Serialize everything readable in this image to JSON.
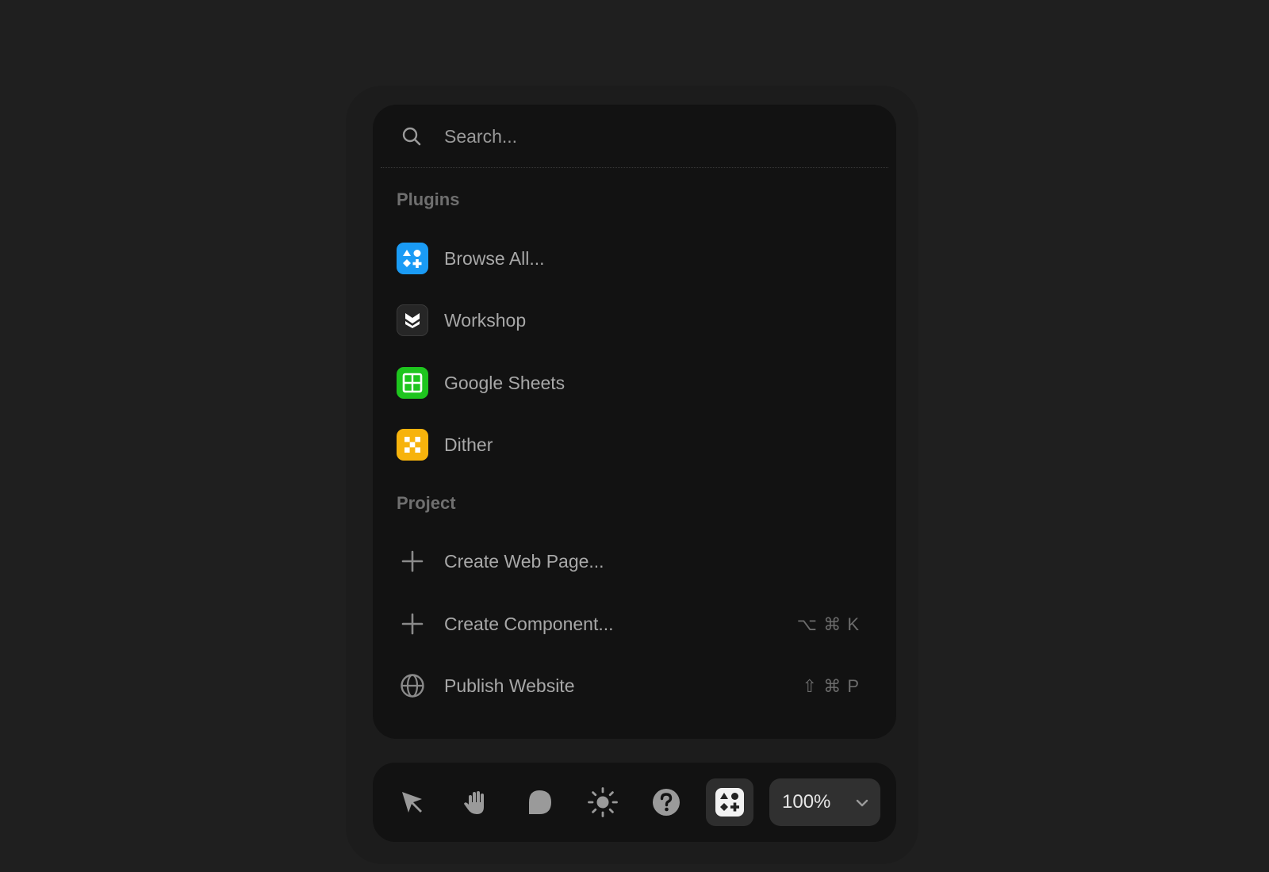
{
  "search": {
    "placeholder": "Search..."
  },
  "sections": {
    "plugins": {
      "title": "Plugins",
      "items": [
        {
          "label": "Browse All...",
          "icon": "plugins-grid-icon",
          "color": "#1a9bf5"
        },
        {
          "label": "Workshop",
          "icon": "workshop-icon",
          "color": "#262626"
        },
        {
          "label": "Google Sheets",
          "icon": "google-sheets-icon",
          "color": "#1ec51e"
        },
        {
          "label": "Dither",
          "icon": "dither-icon",
          "color": "#f7b30c"
        }
      ]
    },
    "project": {
      "title": "Project",
      "items": [
        {
          "label": "Create Web Page...",
          "icon": "plus-icon",
          "shortcut": ""
        },
        {
          "label": "Create Component...",
          "icon": "plus-icon",
          "shortcut": "⌥ ⌘ K"
        },
        {
          "label": "Publish Website",
          "icon": "globe-icon",
          "shortcut": "⇧ ⌘ P"
        }
      ]
    }
  },
  "toolbar": {
    "tools": [
      "select-cursor-icon",
      "hand-icon",
      "comment-icon",
      "theme-sun-icon",
      "help-icon",
      "plugins-grid-icon"
    ],
    "active_tool": "plugins-grid-icon",
    "zoom": "100%"
  }
}
